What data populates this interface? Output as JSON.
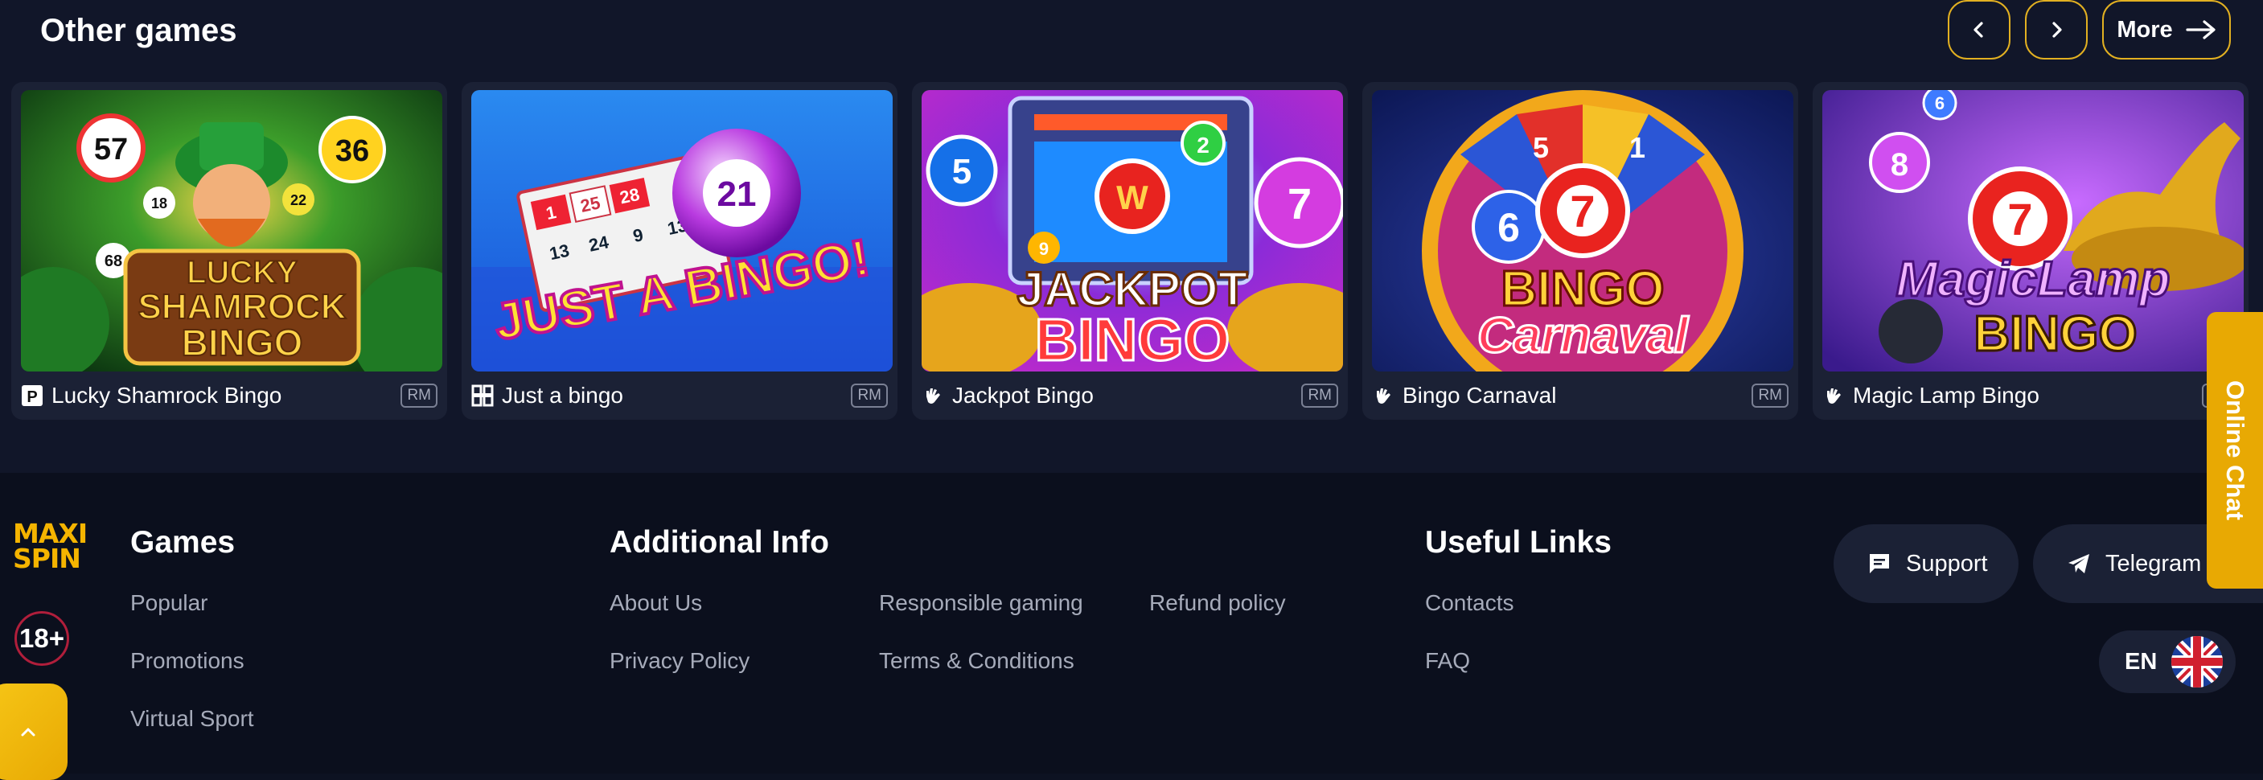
{
  "games_section": {
    "title": "Other games",
    "prev_icon": "chevron-left-icon",
    "next_icon": "chevron-right-icon",
    "more_label": "More",
    "more_icon": "arrow-right-icon",
    "accent_color": "#e2b021",
    "cards": [
      {
        "name": "Lucky Shamrock Bingo",
        "currency": "RM",
        "provider_icon": "provider-p-icon",
        "art_text": [
          "LUCKY",
          "SHAMROCK",
          "BINGO"
        ],
        "ball_numbers": [
          "57",
          "36",
          "18",
          "22",
          "68"
        ]
      },
      {
        "name": "Just a bingo",
        "currency": "RM",
        "provider_icon": "provider-grid-icon",
        "art_text": [
          "JUST A BINGO!"
        ],
        "ball_numbers": [
          "21"
        ],
        "ticket_numbers": [
          "1",
          "25",
          "28",
          "13",
          "24",
          "9",
          "13"
        ]
      },
      {
        "name": "Jackpot Bingo",
        "currency": "RM",
        "provider_icon": "provider-hand-icon",
        "art_text": [
          "JACKPOT",
          "BINGO"
        ],
        "ball_numbers": [
          "5",
          "2",
          "7",
          "9",
          "W"
        ]
      },
      {
        "name": "Bingo Carnaval",
        "currency": "RM",
        "provider_icon": "provider-hand-icon",
        "art_text": [
          "BINGO",
          "Carnaval"
        ],
        "ball_numbers": [
          "7",
          "6",
          "5",
          "1"
        ]
      },
      {
        "name": "Magic Lamp Bingo",
        "currency": "RM",
        "provider_icon": "provider-hand-icon",
        "art_text": [
          "MagicLamp",
          "BINGO"
        ],
        "ball_numbers": [
          "8",
          "7",
          "6"
        ]
      }
    ]
  },
  "footer": {
    "logo_text": [
      "MAXI",
      "SPIN"
    ],
    "age_label": "18+",
    "scroll_top_icon": "chevron-up-icon",
    "games": {
      "heading": "Games",
      "links": [
        "Popular",
        "Promotions",
        "Virtual Sport"
      ]
    },
    "additional": {
      "heading": "Additional Info",
      "links": [
        "About Us",
        "Privacy Policy",
        "Responsible gaming",
        "Terms & Conditions",
        "Refund policy"
      ]
    },
    "useful": {
      "heading": "Useful Links",
      "links": [
        "Contacts",
        "FAQ"
      ]
    },
    "support_label": "Support",
    "support_icon": "chat-icon",
    "telegram_label": "Telegram",
    "telegram_icon": "telegram-icon",
    "language": "EN",
    "language_icon": "uk-flag-icon",
    "online_chat_label": "Online Chat",
    "brand_color": "#f5b400"
  }
}
